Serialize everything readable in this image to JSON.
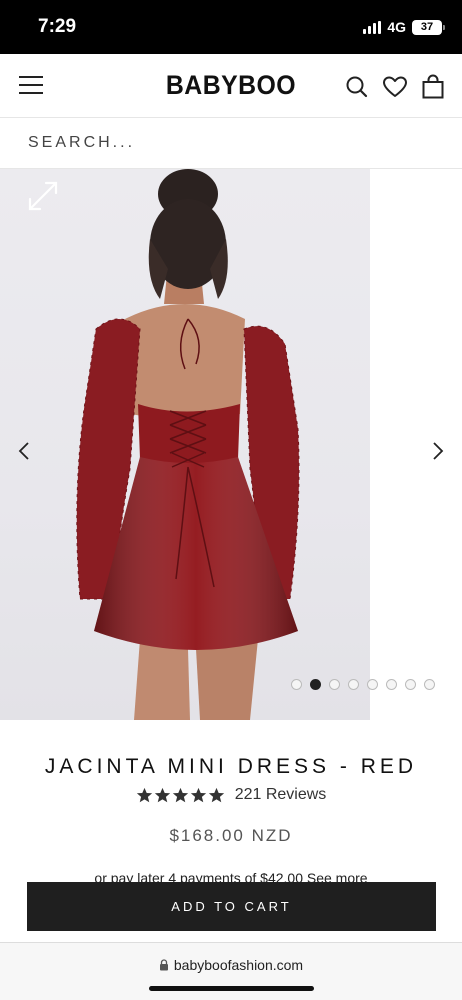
{
  "status_bar": {
    "time": "7:29",
    "network": "4G",
    "battery": "37"
  },
  "header": {
    "brand": "BABYBOO",
    "icons": [
      "menu-icon",
      "search-icon",
      "heart-icon",
      "bag-icon"
    ]
  },
  "search": {
    "placeholder": "SEARCH..."
  },
  "gallery": {
    "image_count": 8,
    "active_index": 0,
    "icons": [
      "expand-icon",
      "chevron-left-icon",
      "chevron-right-icon"
    ]
  },
  "product": {
    "title": "JACINTA MINI DRESS - RED",
    "rating": 5,
    "reviews": "221 Reviews",
    "price": "$168.00 NZD",
    "afterpay": "or pay later 4 payments of $42.00 See more",
    "add_to_cart": "ADD TO CART"
  },
  "browser": {
    "url": "babyboofashion.com"
  },
  "colors": {
    "dress": "#8e1a1f",
    "button": "#1f1f1f",
    "photo_bg": "#eae9ee"
  }
}
